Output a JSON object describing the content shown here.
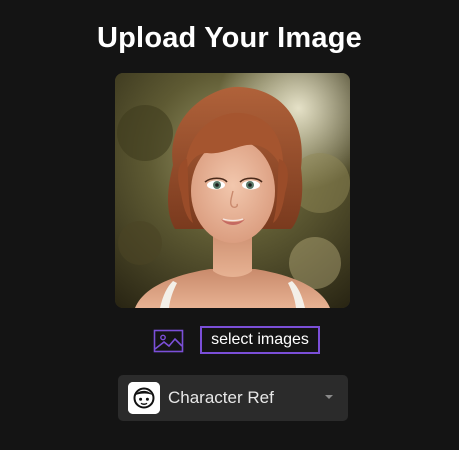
{
  "header": {
    "title": "Upload Your Image"
  },
  "preview": {
    "image_subject": "portrait-photo-woman-short-auburn-hair"
  },
  "upload": {
    "icon": "image-gallery-icon",
    "select_label": "select images",
    "accent_color": "#7b4fd8"
  },
  "model_select": {
    "icon": "character-face-icon",
    "selected": "Character Ref"
  },
  "colors": {
    "background": "#141414",
    "dropdown_bg": "#2b2b2b",
    "accent": "#7b4fd8"
  }
}
